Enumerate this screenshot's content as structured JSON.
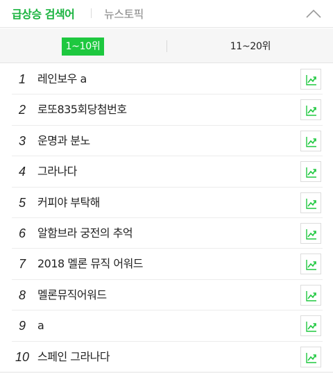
{
  "header": {
    "tab_trending": "급상승 검색어",
    "tab_news": "뉴스토픽",
    "collapse_icon": "chevron-up-icon"
  },
  "range_tabs": {
    "active": "1~10위",
    "inactive": "11~20위"
  },
  "colors": {
    "accent": "#1ec83f",
    "accent_text": "#19b33e"
  },
  "list": [
    {
      "rank": "1",
      "keyword": "레인보우 a"
    },
    {
      "rank": "2",
      "keyword": "로또835회당첨번호"
    },
    {
      "rank": "3",
      "keyword": "운명과 분노"
    },
    {
      "rank": "4",
      "keyword": "그라나다"
    },
    {
      "rank": "5",
      "keyword": "커피야 부탁해"
    },
    {
      "rank": "6",
      "keyword": "알함브라 궁전의 추억"
    },
    {
      "rank": "7",
      "keyword": "2018 멜론 뮤직 어워드"
    },
    {
      "rank": "8",
      "keyword": "멜론뮤직어워드"
    },
    {
      "rank": "9",
      "keyword": "a"
    },
    {
      "rank": "10",
      "keyword": "스페인 그라나다"
    }
  ],
  "trend_icon": "trend-chart-icon"
}
